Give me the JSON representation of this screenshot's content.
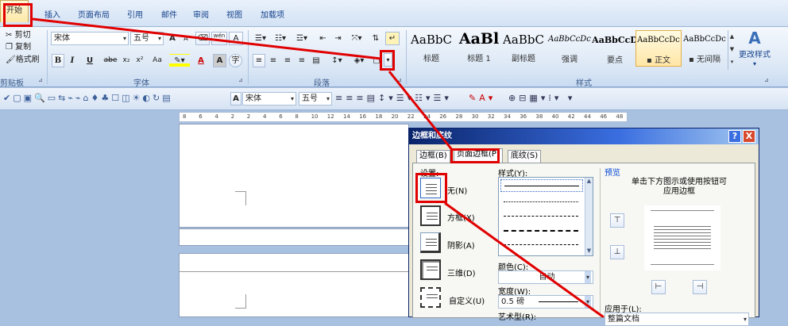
{
  "tabs": {
    "home": "开始",
    "items": [
      "插入",
      "页面布局",
      "引用",
      "邮件",
      "审阅",
      "视图",
      "加载项"
    ]
  },
  "clipboard": {
    "cut": "剪切",
    "copy": "复制",
    "format_painter": "格式刷",
    "group": "剪贴板"
  },
  "font": {
    "name": "宋体",
    "size": "五号",
    "group": "字体",
    "labels": [
      "B",
      "I",
      "U",
      "abe",
      "x₂",
      "x²",
      "Aa",
      "A"
    ],
    "grow": "A",
    "shrink": "A",
    "wen": "wén",
    "a_char": "A"
  },
  "paragraph": {
    "group": "段落"
  },
  "styles": {
    "group": "样式",
    "items": [
      {
        "sample": "AaBbC",
        "label": "标题"
      },
      {
        "sample": "AaBl",
        "label": "标题 1"
      },
      {
        "sample": "AaBbC",
        "label": "副标题"
      },
      {
        "sample": "AaBbCcDc",
        "label": "强调"
      },
      {
        "sample": "AaBbCcD",
        "label": "要点"
      },
      {
        "sample": "AaBbCcDc",
        "label": "正文"
      },
      {
        "sample": "AaBbCcDc",
        "label": "无间隔"
      }
    ],
    "change": "更改样式"
  },
  "toolbar2": {
    "font": "宋体",
    "size": "五号"
  },
  "ruler": [
    "8",
    "6",
    "4",
    "2",
    "2",
    "4",
    "6",
    "8",
    "10",
    "12",
    "14",
    "16",
    "18",
    "20",
    "22",
    "24",
    "26",
    "28",
    "30",
    "32",
    "34",
    "36",
    "38",
    "40",
    "42",
    "44",
    "46",
    "48"
  ],
  "dialog": {
    "title": "边框和底纹",
    "help": "?",
    "close": "X",
    "tabs": [
      "边框(B)",
      "页面边框(P)",
      "底纹(S)"
    ],
    "setting_label": "设置:",
    "settings": [
      "无(N)",
      "方框(X)",
      "阴影(A)",
      "三维(D)",
      "自定义(U)"
    ],
    "style_label": "样式(Y):",
    "color_label": "颜色(C):",
    "color_value": "自动",
    "width_label": "宽度(W):",
    "width_value": "0.5 磅",
    "art_label": "艺术型(R):",
    "preview_label": "预览",
    "preview_hint": "单击下方图示或使用按钮可应用边框",
    "apply_label": "应用于(L):",
    "apply_value": "整篇文档"
  }
}
